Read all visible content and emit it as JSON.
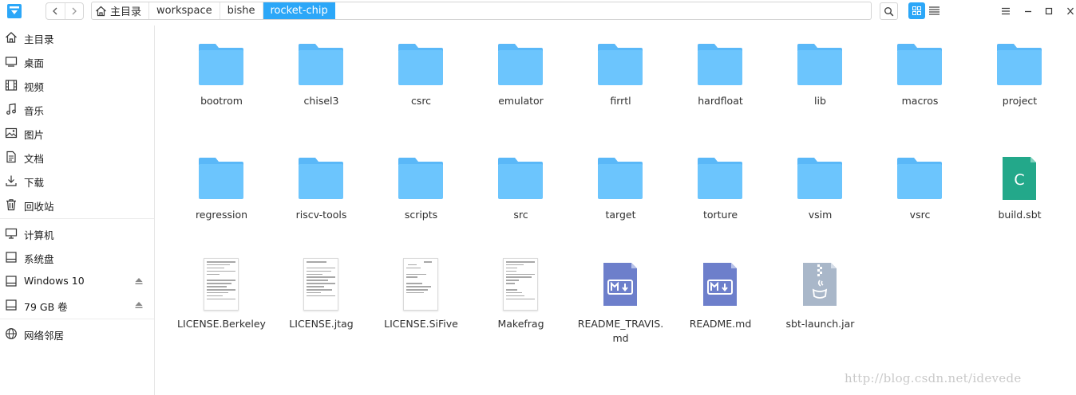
{
  "titlebar": {
    "breadcrumbs": [
      "主目录",
      "workspace",
      "bishe",
      "rocket-chip"
    ],
    "active_crumb": "rocket-chip"
  },
  "sidebar": {
    "items": [
      {
        "label": "主目录",
        "icon": "home-icon"
      },
      {
        "label": "桌面",
        "icon": "desktop-icon"
      },
      {
        "label": "视频",
        "icon": "video-icon"
      },
      {
        "label": "音乐",
        "icon": "music-icon"
      },
      {
        "label": "图片",
        "icon": "picture-icon"
      },
      {
        "label": "文档",
        "icon": "document-icon"
      },
      {
        "label": "下载",
        "icon": "download-icon"
      },
      {
        "label": "回收站",
        "icon": "trash-icon"
      },
      {
        "label": "计算机",
        "icon": "computer-icon"
      },
      {
        "label": "系统盘",
        "icon": "disk-icon"
      },
      {
        "label": "Windows 10",
        "icon": "disk-icon",
        "eject": true
      },
      {
        "label": "79 GB 卷",
        "icon": "disk-icon",
        "eject": true
      },
      {
        "label": "网络邻居",
        "icon": "network-icon"
      }
    ]
  },
  "files": [
    {
      "name": "bootrom",
      "kind": "folder"
    },
    {
      "name": "chisel3",
      "kind": "folder"
    },
    {
      "name": "csrc",
      "kind": "folder"
    },
    {
      "name": "emulator",
      "kind": "folder"
    },
    {
      "name": "firrtl",
      "kind": "folder"
    },
    {
      "name": "hardfloat",
      "kind": "folder"
    },
    {
      "name": "lib",
      "kind": "folder"
    },
    {
      "name": "macros",
      "kind": "folder"
    },
    {
      "name": "project",
      "kind": "folder"
    },
    {
      "name": "regression",
      "kind": "folder"
    },
    {
      "name": "riscv-tools",
      "kind": "folder"
    },
    {
      "name": "scripts",
      "kind": "folder"
    },
    {
      "name": "src",
      "kind": "folder"
    },
    {
      "name": "target",
      "kind": "folder"
    },
    {
      "name": "torture",
      "kind": "folder"
    },
    {
      "name": "vsim",
      "kind": "folder"
    },
    {
      "name": "vsrc",
      "kind": "folder"
    },
    {
      "name": "build.sbt",
      "kind": "scala",
      "glyph": "C"
    },
    {
      "name": "LICENSE.Berkeley",
      "kind": "text"
    },
    {
      "name": "LICENSE.jtag",
      "kind": "text"
    },
    {
      "name": "LICENSE.SiFive",
      "kind": "text"
    },
    {
      "name": "Makefrag",
      "kind": "text"
    },
    {
      "name": "README_TRAVIS.md",
      "kind": "markdown"
    },
    {
      "name": "README.md",
      "kind": "markdown"
    },
    {
      "name": "sbt-launch.jar",
      "kind": "jar"
    }
  ],
  "watermark": "http://blog.csdn.net/idevede",
  "colors": {
    "accent": "#2ca7f8",
    "folder": "#6cc5fd",
    "folder_tab": "#5ab8f8",
    "scala": "#23a88a",
    "markdown": "#6d7fcb",
    "jar": "#a9b7c9"
  }
}
